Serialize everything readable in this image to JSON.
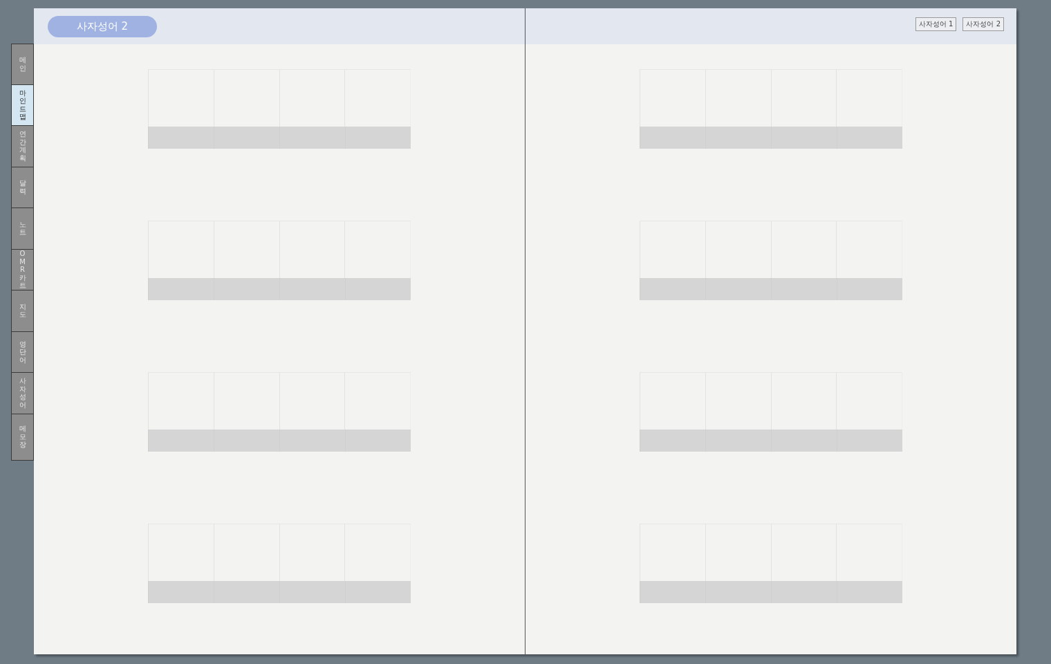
{
  "side_tabs": [
    {
      "label": "메인",
      "selected": false
    },
    {
      "label": "마인드맵",
      "selected": true
    },
    {
      "label": "연간계획",
      "selected": false
    },
    {
      "label": "달력",
      "selected": false
    },
    {
      "label": "노트",
      "selected": false
    },
    {
      "label": "OMR카트",
      "selected": false
    },
    {
      "label": "지도",
      "selected": false
    },
    {
      "label": "영단어",
      "selected": false
    },
    {
      "label": "사자성어",
      "selected": false
    },
    {
      "label": "메모장",
      "selected": false
    }
  ],
  "header": {
    "title": "사자성어 2",
    "buttons": [
      {
        "label": "사자성어 1"
      },
      {
        "label": "사자성어 2"
      }
    ]
  }
}
